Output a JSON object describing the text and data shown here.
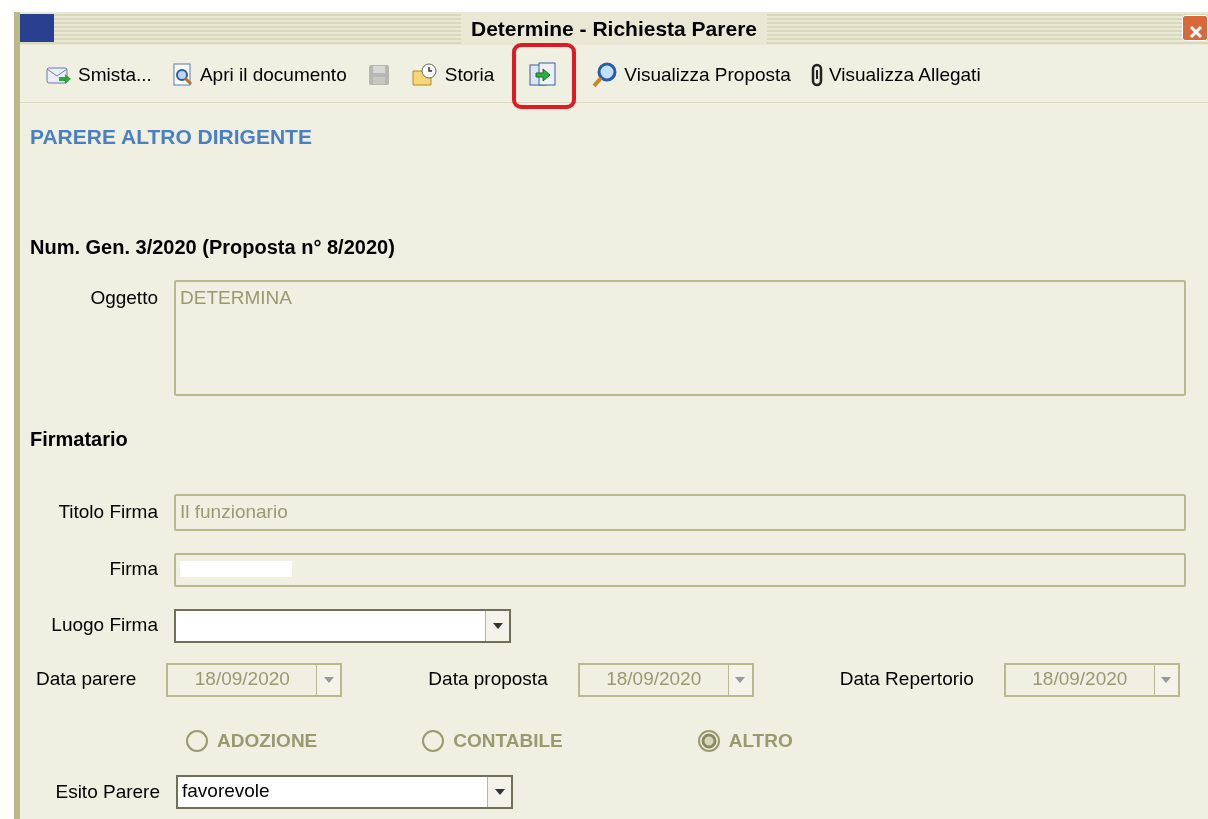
{
  "window": {
    "title": "Determine - Richiesta Parere"
  },
  "toolbar": [
    {
      "kind": "forward",
      "label": "Smista...",
      "disabled": false,
      "highlighted": false
    },
    {
      "kind": "preview",
      "label": "Apri il documento",
      "disabled": false,
      "highlighted": false
    },
    {
      "kind": "save",
      "disabled": true,
      "highlighted": false
    },
    {
      "kind": "history",
      "label": "Storia",
      "disabled": false,
      "highlighted": false
    },
    {
      "kind": "transfer",
      "disabled": false,
      "highlighted": true
    },
    {
      "kind": "search",
      "label": "Visualizza Proposta",
      "disabled": false,
      "highlighted": false
    },
    {
      "kind": "attach",
      "label": "Visualizza Allegati",
      "disabled": false,
      "highlighted": false
    }
  ],
  "section_title": "PARERE ALTRO DIRIGENTE",
  "heading": "Num. Gen. 3/2020 (Proposta n° 8/2020)",
  "oggetto": {
    "label": "Oggetto",
    "value": "DETERMINA",
    "disabled": true
  },
  "firmatario": {
    "heading": "Firmatario",
    "titolo_firma": {
      "label": "Titolo Firma",
      "value": "Il funzionario",
      "disabled": true
    },
    "firma": {
      "label": "Firma",
      "disabled": true,
      "redacted": true
    },
    "luogo_firma": {
      "label": "Luogo Firma",
      "disabled": false
    }
  },
  "dates": [
    {
      "label": "Data parere",
      "value": "18/09/2020",
      "disabled": true
    },
    {
      "label": "Data proposta",
      "value": "18/09/2020",
      "disabled": true
    },
    {
      "label": "Data Repertorio",
      "value": "18/09/2020",
      "disabled": true
    }
  ],
  "radios": [
    {
      "label": "ADOZIONE",
      "selected": false,
      "disabled": true
    },
    {
      "label": "CONTABILE",
      "selected": false,
      "disabled": true
    },
    {
      "label": "ALTRO",
      "selected": true,
      "disabled": true
    }
  ],
  "esito": {
    "label": "Esito Parere",
    "value": "favorevole",
    "disabled": false
  }
}
